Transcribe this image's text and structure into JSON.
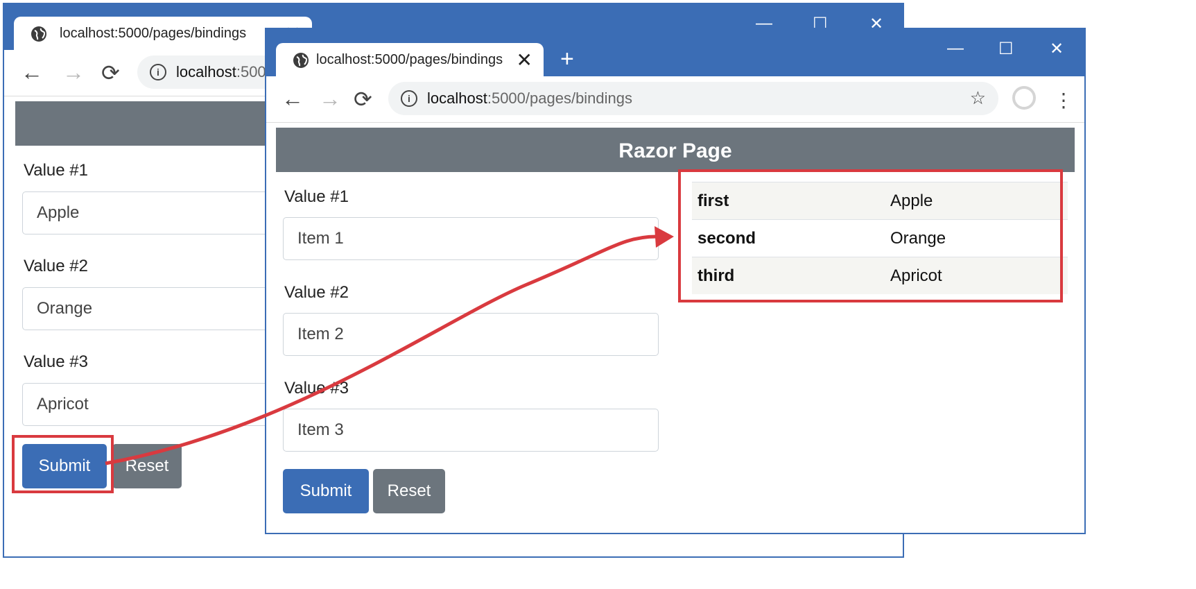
{
  "browser": {
    "tab_title": "localhost:5000/pages/bindings",
    "close_glyph": "✕",
    "newtab_glyph": "+",
    "url_host": "localhost",
    "url_rest": ":5000/pages/bindings",
    "back_glyph": "←",
    "forward_glyph": "→",
    "reload_glyph": "⟳",
    "info_glyph": "i",
    "star_glyph": "☆",
    "menu_glyph": "⋮",
    "minimize_glyph": "—",
    "maximize_glyph": "☐",
    "window_close_glyph": "✕"
  },
  "back_window": {
    "fields": [
      {
        "label": "Value #1",
        "value": "Apple"
      },
      {
        "label": "Value #2",
        "value": "Orange"
      },
      {
        "label": "Value #3",
        "value": "Apricot"
      }
    ],
    "submit_label": "Submit",
    "reset_label": "Reset"
  },
  "front_window": {
    "header": "Razor Page",
    "fields": [
      {
        "label": "Value #1",
        "value": "Item 1"
      },
      {
        "label": "Value #2",
        "value": "Item 2"
      },
      {
        "label": "Value #3",
        "value": "Item 3"
      }
    ],
    "submit_label": "Submit",
    "reset_label": "Reset",
    "results": [
      {
        "key": "first",
        "value": "Apple"
      },
      {
        "key": "second",
        "value": "Orange"
      },
      {
        "key": "third",
        "value": "Apricot"
      }
    ]
  },
  "colors": {
    "chrome_blue": "#3b6db5",
    "header_gray": "#6c757d",
    "highlight_red": "#d93a3f"
  },
  "icons": [
    "globe-icon",
    "close-icon",
    "plus-icon",
    "back-arrow-icon",
    "forward-arrow-icon",
    "reload-icon",
    "info-icon",
    "star-icon",
    "avatar-icon",
    "kebab-menu-icon",
    "minimize-icon",
    "maximize-icon"
  ]
}
